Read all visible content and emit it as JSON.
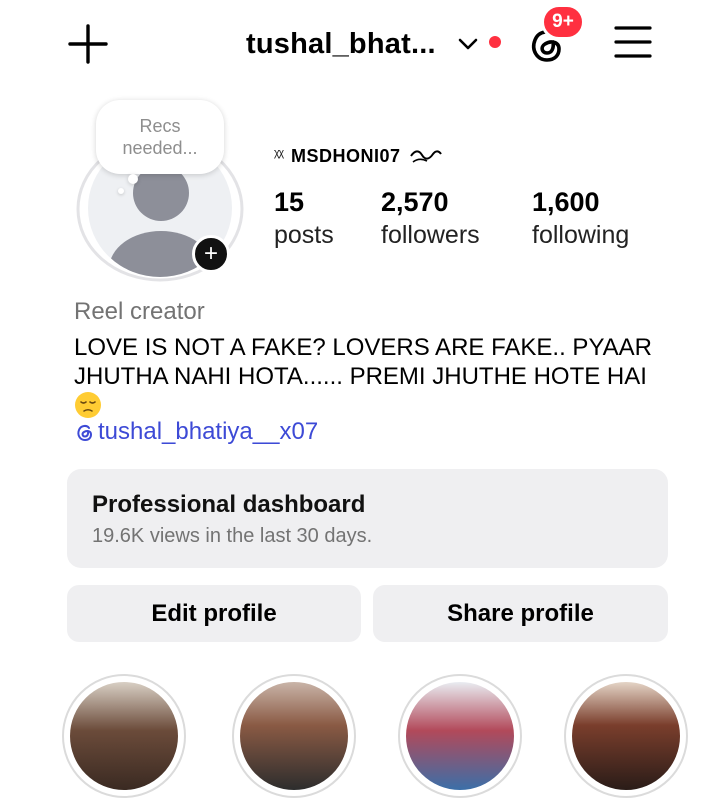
{
  "header": {
    "username": "tushal_bhat...",
    "threads_badge": "9+"
  },
  "profile": {
    "note": "Recs\nneeded...",
    "name_prefix": "ᵡᵡ",
    "display_name": "MSDHONI07",
    "stats": [
      {
        "value": "15",
        "label": "posts"
      },
      {
        "value": "2,570",
        "label": "followers"
      },
      {
        "value": "1,600",
        "label": "following"
      }
    ],
    "category": "Reel creator",
    "bio": "LOVE IS NOT A FAKE? LOVERS ARE FAKE.. PYAAR JHUTHA NAHI HOTA...... PREMI JHUTHE HOTE HAI",
    "threads_handle": "tushal_bhatiya__x07"
  },
  "dashboard": {
    "title": "Professional dashboard",
    "subtitle": "19.6K views in the last 30 days."
  },
  "actions": {
    "edit_label": "Edit profile",
    "share_label": "Share profile"
  },
  "colors": {
    "accent_red": "#ff3040",
    "link_blue": "#3d4ad6",
    "muted_gray": "#737373",
    "button_bg": "#efeff1"
  },
  "icons": [
    "plus-icon",
    "chevron-down-icon",
    "threads-icon",
    "hamburger-menu-icon",
    "add-story-icon",
    "pensive-face-emoji",
    "threads-link-icon"
  ]
}
